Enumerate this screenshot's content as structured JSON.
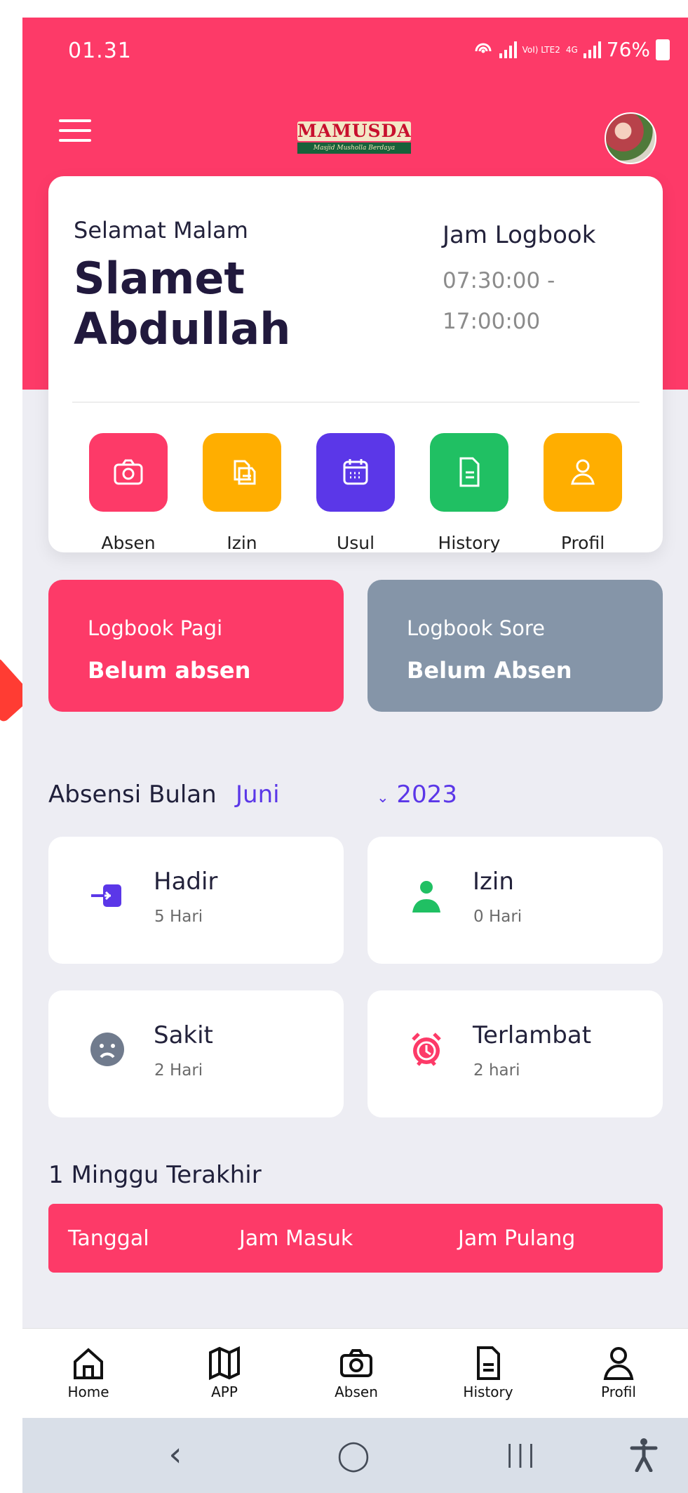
{
  "status_bar": {
    "time": "01.31",
    "network_a": "VoI) LTE2",
    "network_b": "4G",
    "battery": "76%"
  },
  "brand": {
    "logo_title": "MAMUSDA",
    "logo_subtitle": "Masjid Musholla Berdaya"
  },
  "greeting": {
    "salutation": "Selamat Malam",
    "user_name": "Slamet Abdullah"
  },
  "logbook_hours": {
    "title": "Jam Logbook",
    "time_range": "07:30:00 - 17:00:00"
  },
  "quick_actions": [
    {
      "label": "Absen",
      "icon": "camera-icon",
      "color": "#fd3a68"
    },
    {
      "label": "Izin",
      "icon": "documents-icon",
      "color": "#ffae00"
    },
    {
      "label": "Usul",
      "icon": "calendar-icon",
      "color": "#5b37e8"
    },
    {
      "label": "History",
      "icon": "document-icon",
      "color": "#20c063"
    },
    {
      "label": "Profil",
      "icon": "user-icon",
      "color": "#ffae00"
    }
  ],
  "logbook_status": [
    {
      "title": "Logbook Pagi",
      "status": "Belum absen",
      "color": "#fd3a68"
    },
    {
      "title": "Logbook Sore",
      "status": "Belum Absen",
      "color": "#8595a8"
    }
  ],
  "monthly_attendance": {
    "title": "Absensi Bulan",
    "month": "Juni",
    "year": "2023",
    "cards": [
      {
        "title": "Hadir",
        "value": "5 Hari",
        "icon": "login-icon"
      },
      {
        "title": "Izin",
        "value": "0 Hari",
        "icon": "person-icon"
      },
      {
        "title": "Sakit",
        "value": "2 Hari",
        "icon": "sad-face-icon"
      },
      {
        "title": "Terlambat",
        "value": "2 hari",
        "icon": "alarm-clock-icon"
      }
    ]
  },
  "last_week": {
    "title": "1 Minggu Terakhir",
    "columns": [
      "Tanggal",
      "Jam Masuk",
      "Jam Pulang"
    ]
  },
  "bottom_nav": [
    {
      "label": "Home",
      "icon": "home-icon"
    },
    {
      "label": "APP",
      "icon": "map-icon"
    },
    {
      "label": "Absen",
      "icon": "camera-icon"
    },
    {
      "label": "History",
      "icon": "document-icon"
    },
    {
      "label": "Profil",
      "icon": "user-icon"
    }
  ],
  "android_nav": {
    "back": "‹",
    "home": "◯",
    "recents": "|||",
    "accessibility": "accessibility-icon"
  }
}
